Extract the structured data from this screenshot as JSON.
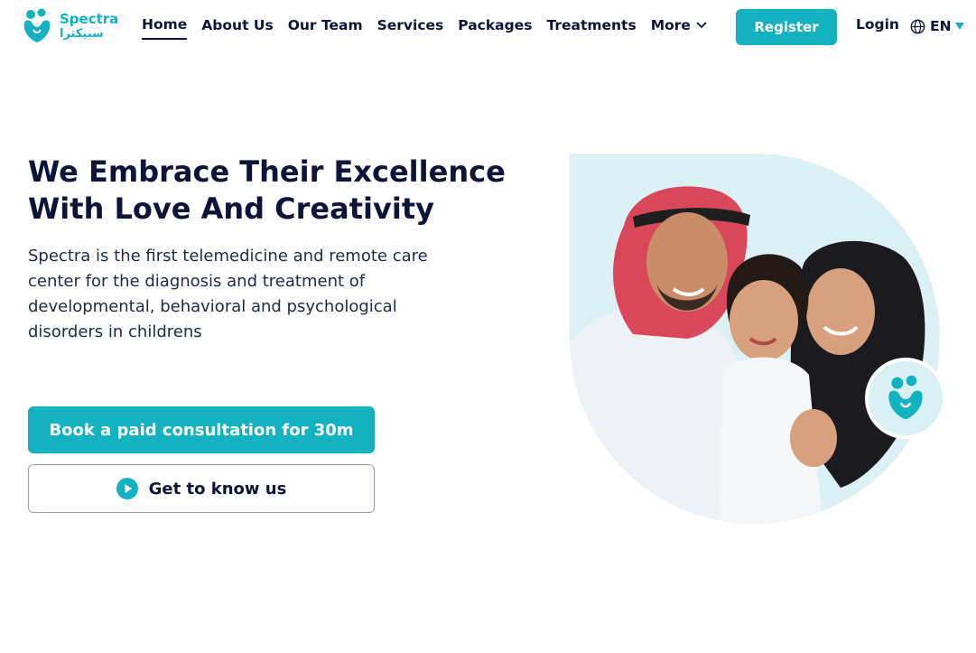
{
  "brand": {
    "name_en": "Spectra",
    "name_ar": "سبيكترا",
    "color": "#14b1c1"
  },
  "nav": {
    "items": [
      {
        "label": "Home",
        "active": true
      },
      {
        "label": "About Us"
      },
      {
        "label": "Our Team"
      },
      {
        "label": "Services"
      },
      {
        "label": "Packages"
      },
      {
        "label": "Treatments"
      },
      {
        "label": "More"
      }
    ],
    "register_label": "Register",
    "login_label": "Login",
    "language": "EN"
  },
  "hero": {
    "title_line1": "We Embrace Their Excellence",
    "title_line2": "With Love And Creativity",
    "description": "Spectra is the first telemedicine and remote care center for the diagnosis and treatment of developmental, behavioral and psychological disorders in childrens",
    "primary_cta": "Book a paid consultation for 30m",
    "secondary_cta": "Get to know us"
  },
  "icons": [
    "spectra-logo-icon",
    "chevron-down-icon",
    "globe-icon",
    "caret-down-icon",
    "play-icon",
    "spectra-badge-icon"
  ]
}
